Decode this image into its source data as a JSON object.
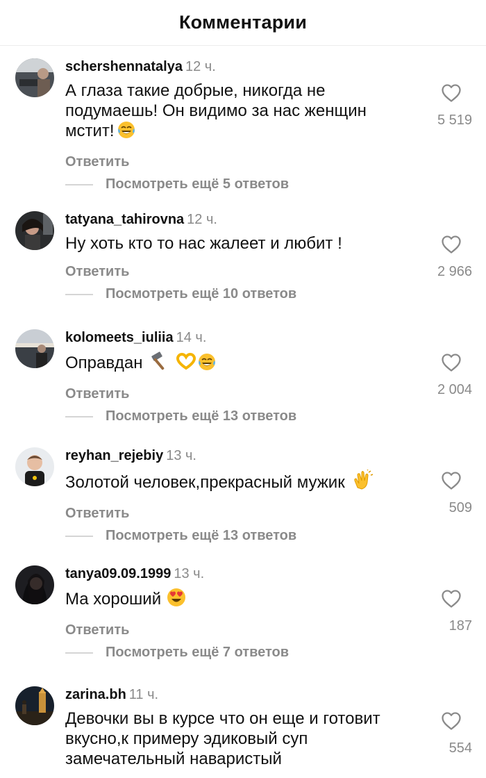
{
  "header": {
    "title": "Комментарии"
  },
  "comments": [
    {
      "username": "schershennatalya",
      "time": "12 ч.",
      "text": "А глаза такие добрые, никогда не подумаешь! Он видимо за нас женщин мстит!",
      "emoji": "laughing-crying-emoji",
      "reply_label": "Ответить",
      "view_replies": "Посмотреть ещё 5 ответов",
      "likes": "5 519"
    },
    {
      "username": "tatyana_tahirovna",
      "time": "12 ч.",
      "text": "Ну хоть кто то нас жалеет и любит !",
      "reply_label": "Ответить",
      "view_replies": "Посмотреть ещё 10 ответов",
      "likes": "2 966"
    },
    {
      "username": "kolomeets_iuliia",
      "time": "14 ч.",
      "text": "Оправдан",
      "emoji": "hammer-heart-hands-laughing-emojis",
      "reply_label": "Ответить",
      "view_replies": "Посмотреть ещё 13 ответов",
      "likes": "2 004"
    },
    {
      "username": "reyhan_rejebiy",
      "time": "13 ч.",
      "text": "Золотой человек,прекрасный мужик",
      "emoji": "clapping-hands-emoji",
      "reply_label": "Ответить",
      "view_replies": "Посмотреть ещё 13 ответов",
      "likes": "509"
    },
    {
      "username": "tanya09.09.1999",
      "time": "13 ч.",
      "text": "Ма хороший",
      "emoji": "heart-eyes-emoji",
      "reply_label": "Ответить",
      "view_replies": "Посмотреть ещё 7 ответов",
      "likes": "187"
    },
    {
      "username": "zarina.bh",
      "time": "11 ч.",
      "text": "Девочки вы в курсе что он еще и готовит вкусно,к примеру эдиковый суп замечательный наваристый",
      "likes": "554"
    }
  ],
  "colors": {
    "text": "#111111",
    "muted": "#8a8a8a",
    "divider": "#d5d5d5",
    "emoji_yellow": "#fbc02d"
  },
  "icons": {
    "like": "heart-outline-icon"
  }
}
